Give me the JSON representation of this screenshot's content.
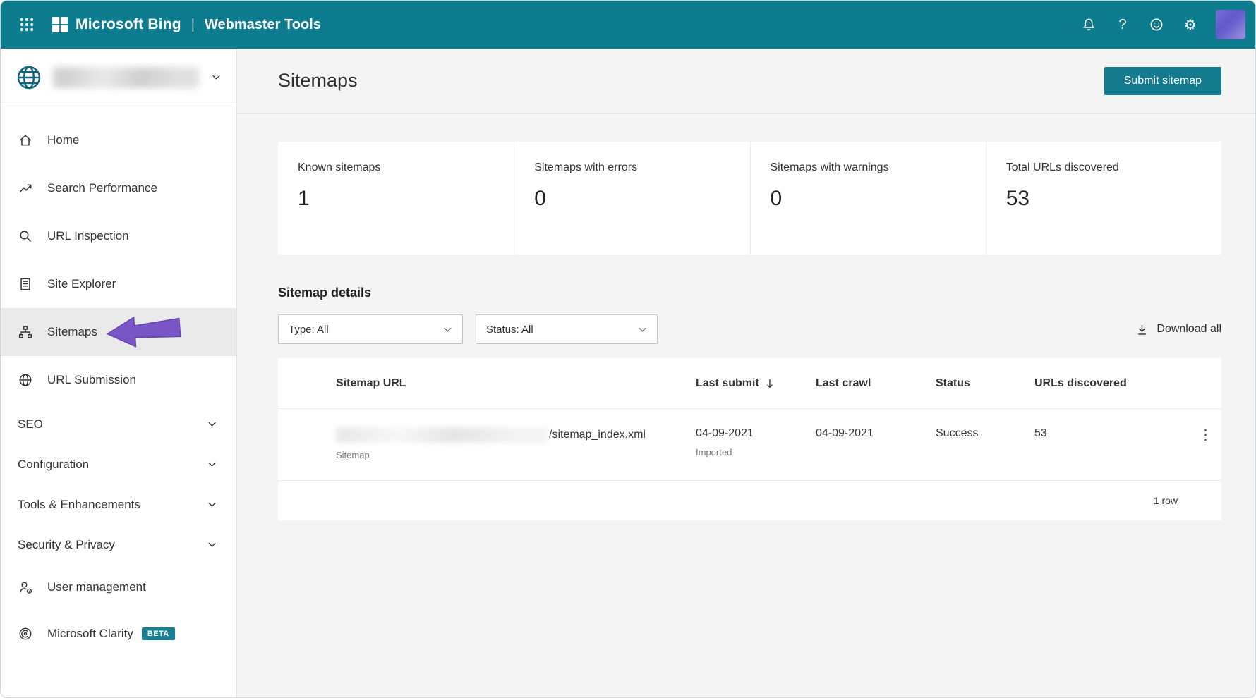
{
  "colors": {
    "topbar_teal": "#0d7c8e",
    "button_teal": "#147a8d",
    "annotation_purple": "#7a55c5",
    "active_item_bg": "#eaeaea",
    "page_bg": "#f4f4f4"
  },
  "topbar": {
    "brand": "Microsoft Bing",
    "separator": "|",
    "product": "Webmaster Tools",
    "help_glyph": "?",
    "gear_glyph": "⚙"
  },
  "sidebar": {
    "site_selector": {
      "icon": "globe-icon",
      "name_redacted": true
    },
    "items": [
      {
        "label": "Home",
        "icon": "home-icon"
      },
      {
        "label": "Search Performance",
        "icon": "trend-icon"
      },
      {
        "label": "URL Inspection",
        "icon": "magnifier-icon"
      },
      {
        "label": "Site Explorer",
        "icon": "document-icon"
      },
      {
        "label": "Sitemaps",
        "icon": "sitemap-icon",
        "active": true
      },
      {
        "label": "URL Submission",
        "icon": "globe-icon"
      },
      {
        "label": "SEO",
        "icon": "chevron-down-icon",
        "expandable": true
      },
      {
        "label": "Configuration",
        "icon": "chevron-down-icon",
        "expandable": true
      },
      {
        "label": "Tools & Enhancements",
        "icon": "chevron-down-icon",
        "expandable": true
      },
      {
        "label": "Security & Privacy",
        "icon": "chevron-down-icon",
        "expandable": true
      },
      {
        "label": "User management",
        "icon": "person-icon"
      },
      {
        "label": "Microsoft Clarity",
        "icon": "clarity-icon",
        "badge": "BETA"
      }
    ]
  },
  "main": {
    "page_title": "Sitemaps",
    "submit_button_label": "Submit sitemap",
    "stats": [
      {
        "label": "Known sitemaps",
        "value": "1"
      },
      {
        "label": "Sitemaps with errors",
        "value": "0"
      },
      {
        "label": "Sitemaps with warnings",
        "value": "0"
      },
      {
        "label": "Total URLs discovered",
        "value": "53"
      }
    ],
    "details_heading": "Sitemap details",
    "filters": {
      "type_label": "Type: All",
      "status_label": "Status: All"
    },
    "download_all_label": "Download all",
    "table": {
      "headers": {
        "url": "Sitemap URL",
        "last_submit": "Last submit",
        "last_crawl": "Last crawl",
        "status": "Status",
        "urls_discovered": "URLs discovered"
      },
      "row": {
        "url_redacted": true,
        "url_visible_suffix": "/sitemap_index.xml",
        "type_label": "Sitemap",
        "last_submit": "04-09-2021",
        "last_submit_note": "Imported",
        "last_crawl": "04-09-2021",
        "status": "Success",
        "urls_discovered": "53",
        "kebab_glyph": "⋮"
      },
      "footer": "1 row"
    }
  }
}
